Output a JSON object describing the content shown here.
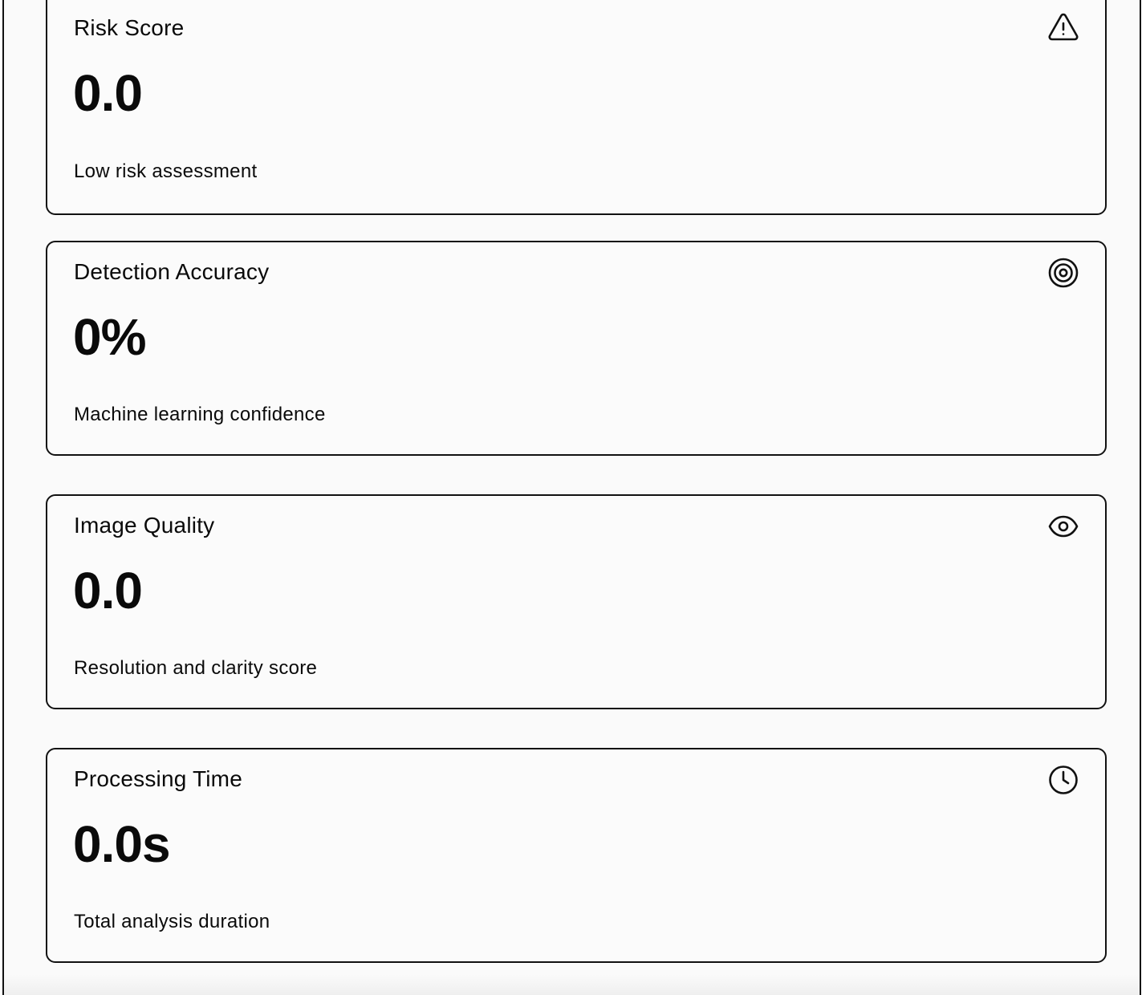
{
  "metrics": [
    {
      "title": "Risk Score",
      "value": "0.0",
      "description": "Low risk assessment",
      "icon": "alert-triangle-icon"
    },
    {
      "title": "Detection Accuracy",
      "value": "0%",
      "description": "Machine learning confidence",
      "icon": "target-icon"
    },
    {
      "title": "Image Quality",
      "value": "0.0",
      "description": "Resolution and clarity score",
      "icon": "eye-icon"
    },
    {
      "title": "Processing Time",
      "value": "0.0s",
      "description": "Total analysis duration",
      "icon": "clock-icon"
    }
  ],
  "colors": {
    "text": "#0a0a0a",
    "border": "#111111",
    "card_background": "#fbfbfb"
  }
}
